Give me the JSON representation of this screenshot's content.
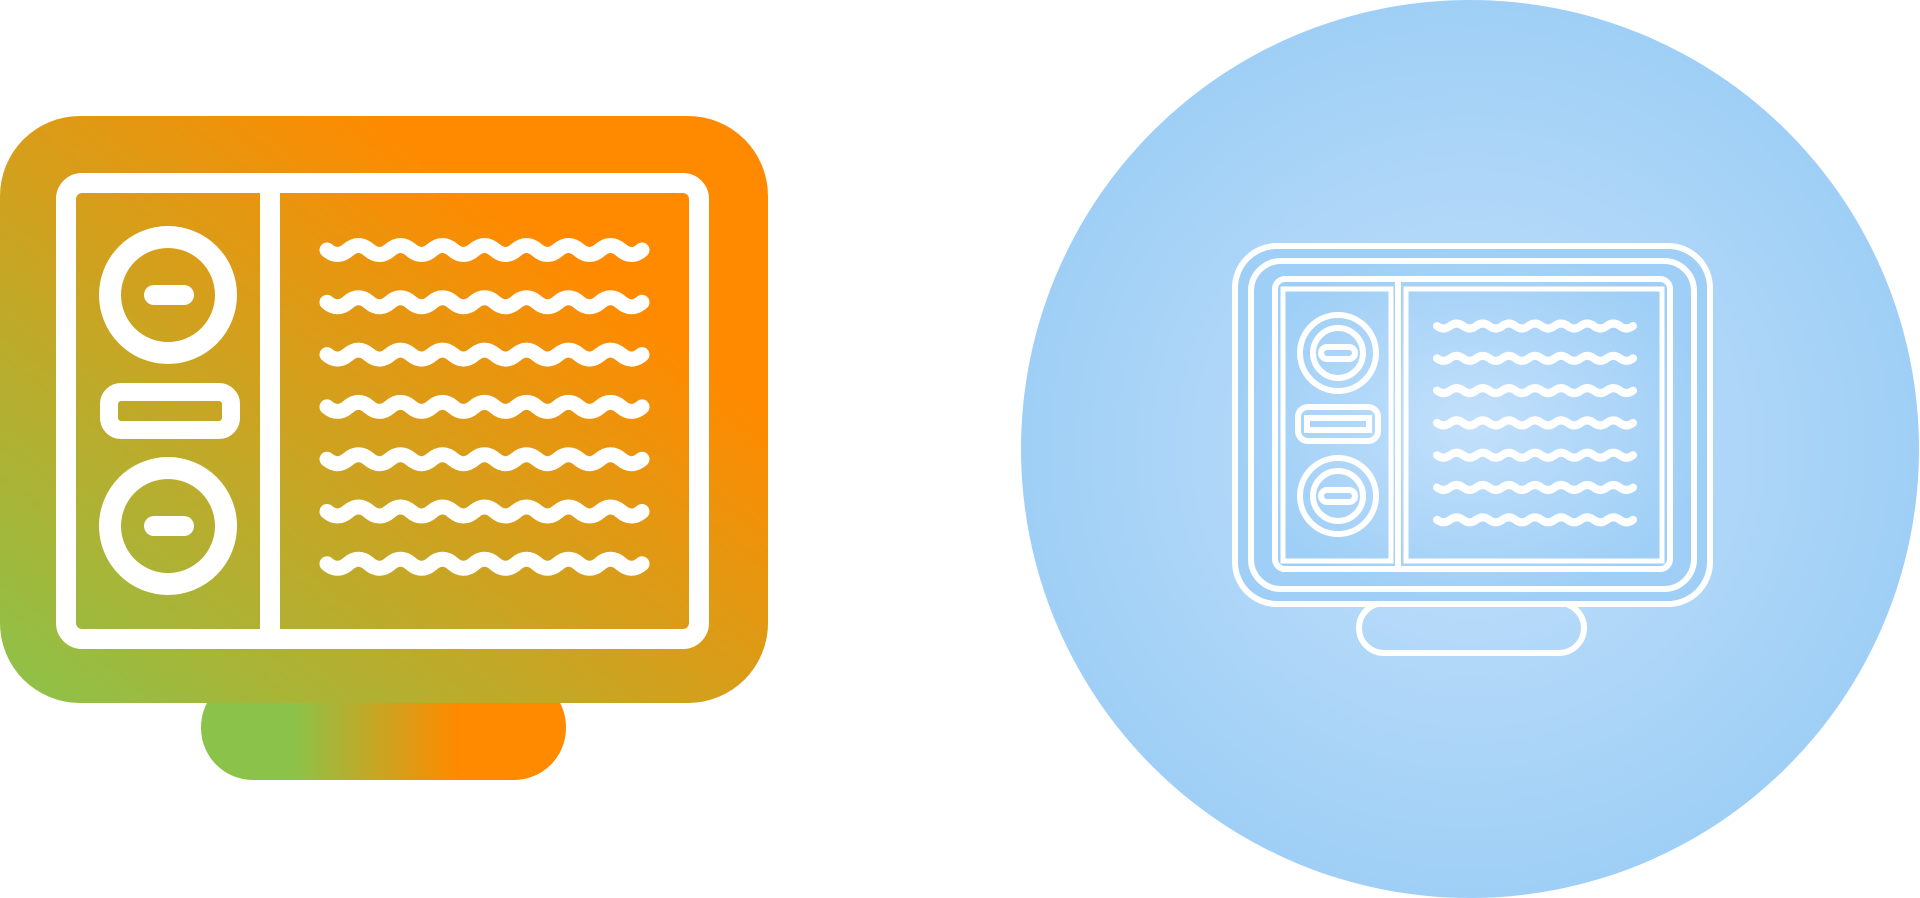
{
  "colors": {
    "background": "#ffffff",
    "gradient_green": "#8BC34A",
    "gradient_orange": "#FF8A00",
    "circle_light": "#C3E0FB",
    "circle_blue": "#9FCFF6",
    "outline": "#ffffff"
  },
  "icons": [
    {
      "name": "monitor-dashboard-icon",
      "style": "glyph-gradient"
    },
    {
      "name": "monitor-dashboard-icon",
      "style": "line-on-circle"
    }
  ],
  "content_rows": 7
}
